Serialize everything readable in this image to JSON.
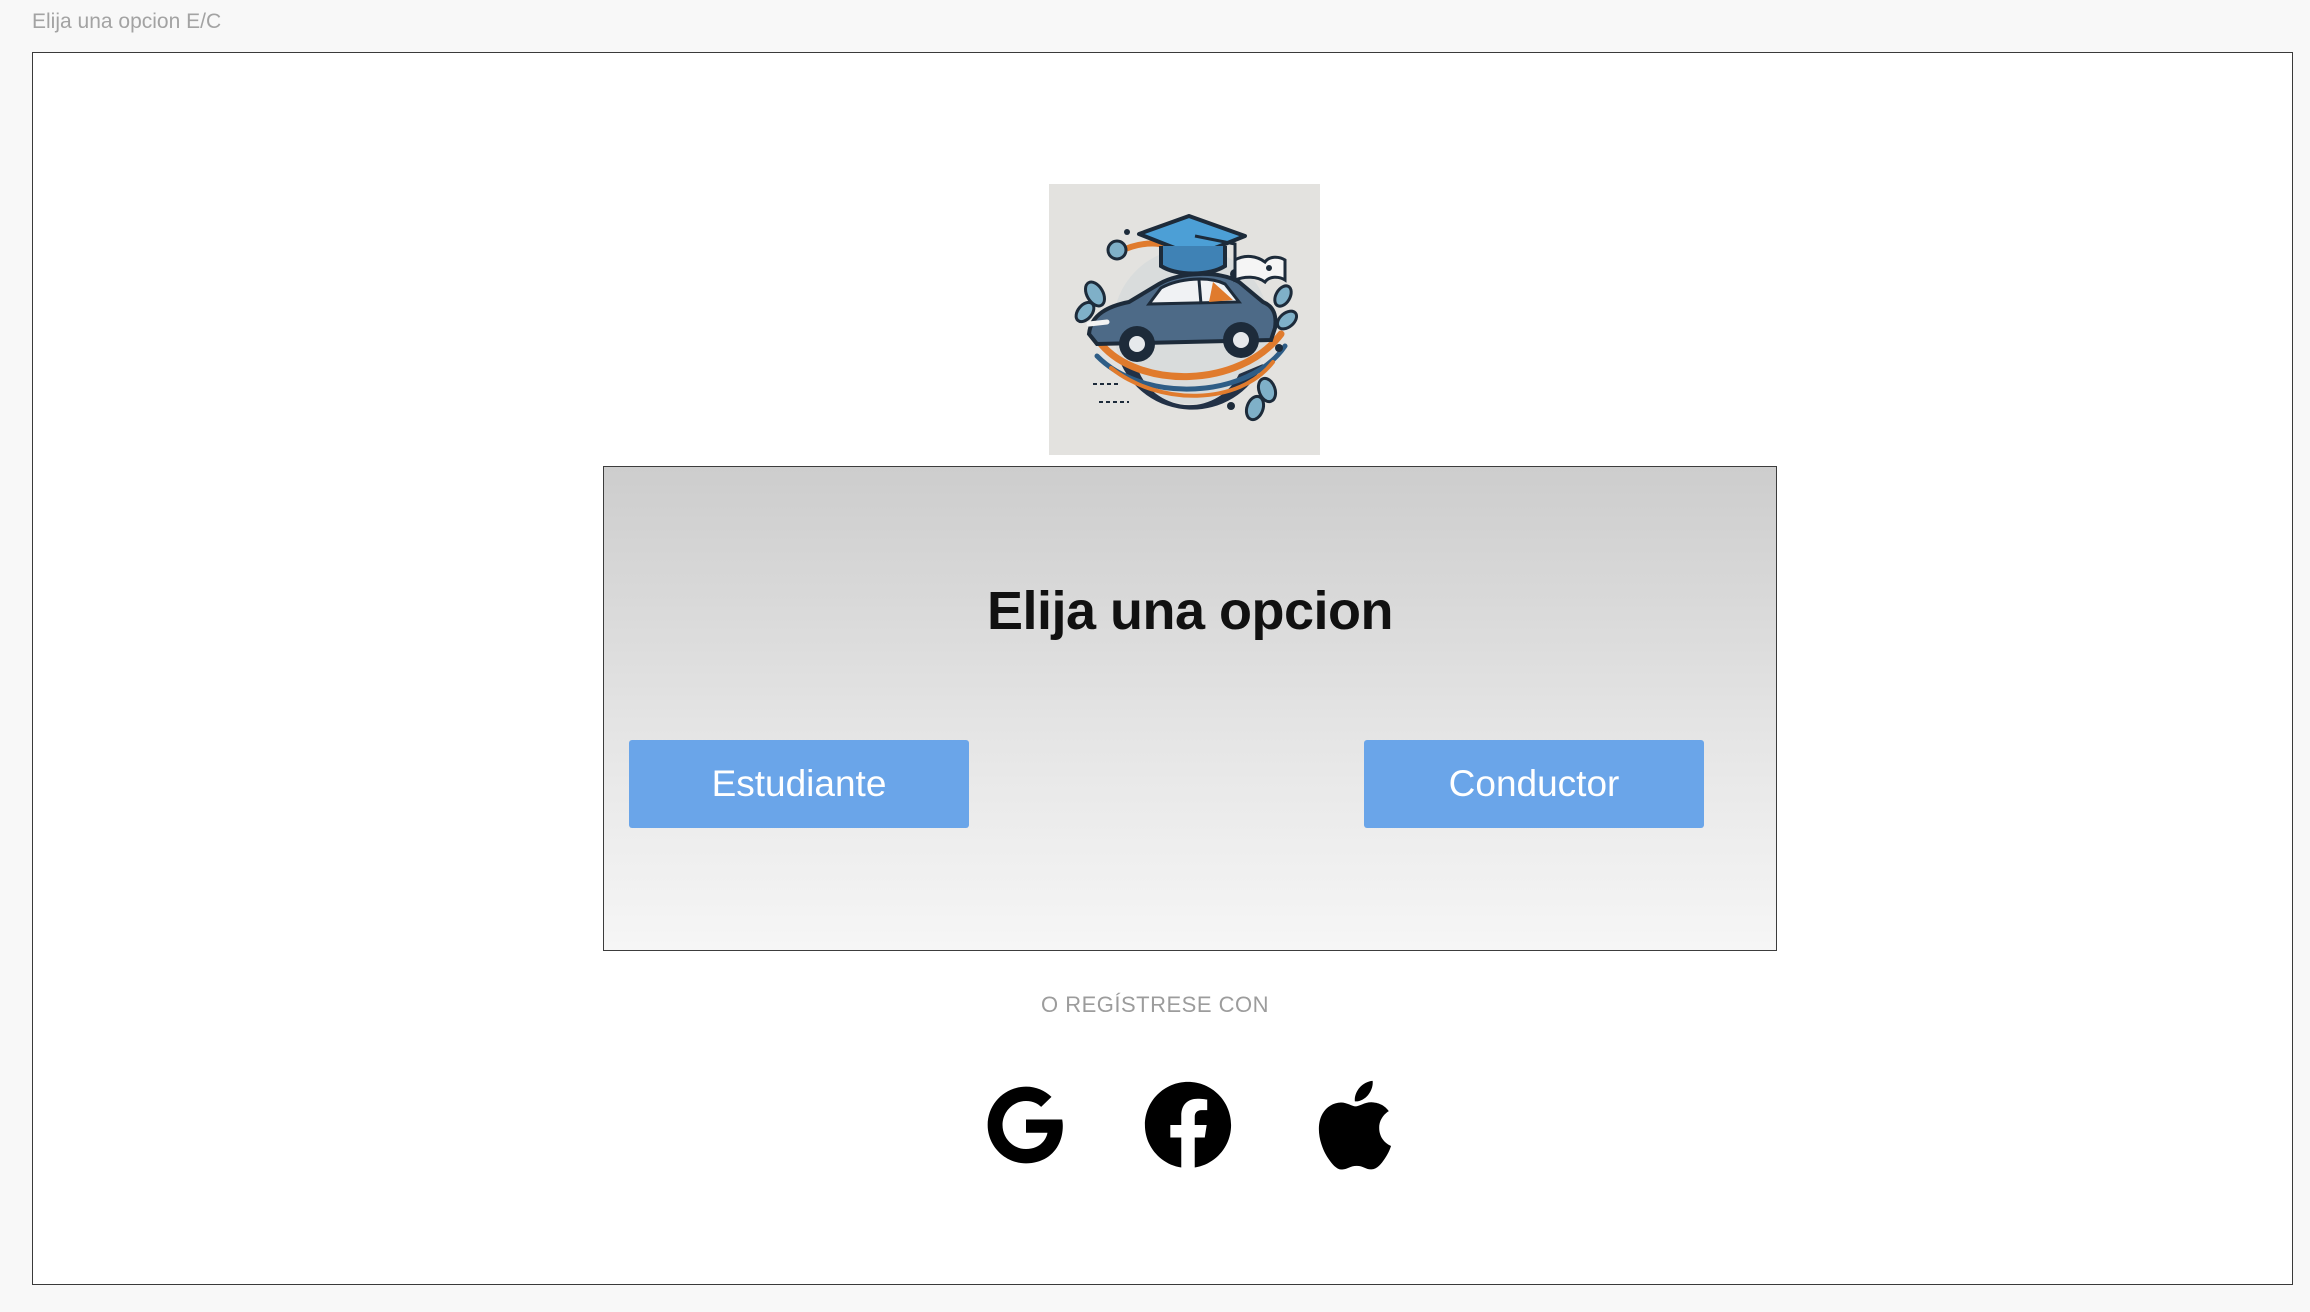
{
  "frame": {
    "label": "Elija una opcion E/C"
  },
  "logo": {
    "icon": "graduation-car-logo"
  },
  "card": {
    "title": "Elija una opcion",
    "buttons": [
      {
        "label": "Estudiante"
      },
      {
        "label": "Conductor"
      }
    ]
  },
  "social": {
    "label": "O REGÍSTRESE CON",
    "providers": [
      {
        "icon": "google-icon"
      },
      {
        "icon": "facebook-icon"
      },
      {
        "icon": "apple-icon"
      }
    ]
  },
  "colors": {
    "button": "#6aa5e9",
    "button_text": "#ffffff",
    "title_text": "#111111",
    "muted_text": "#9c9c9c",
    "page_background": "#f8f8f8",
    "logo_background": "#e3e2df"
  }
}
